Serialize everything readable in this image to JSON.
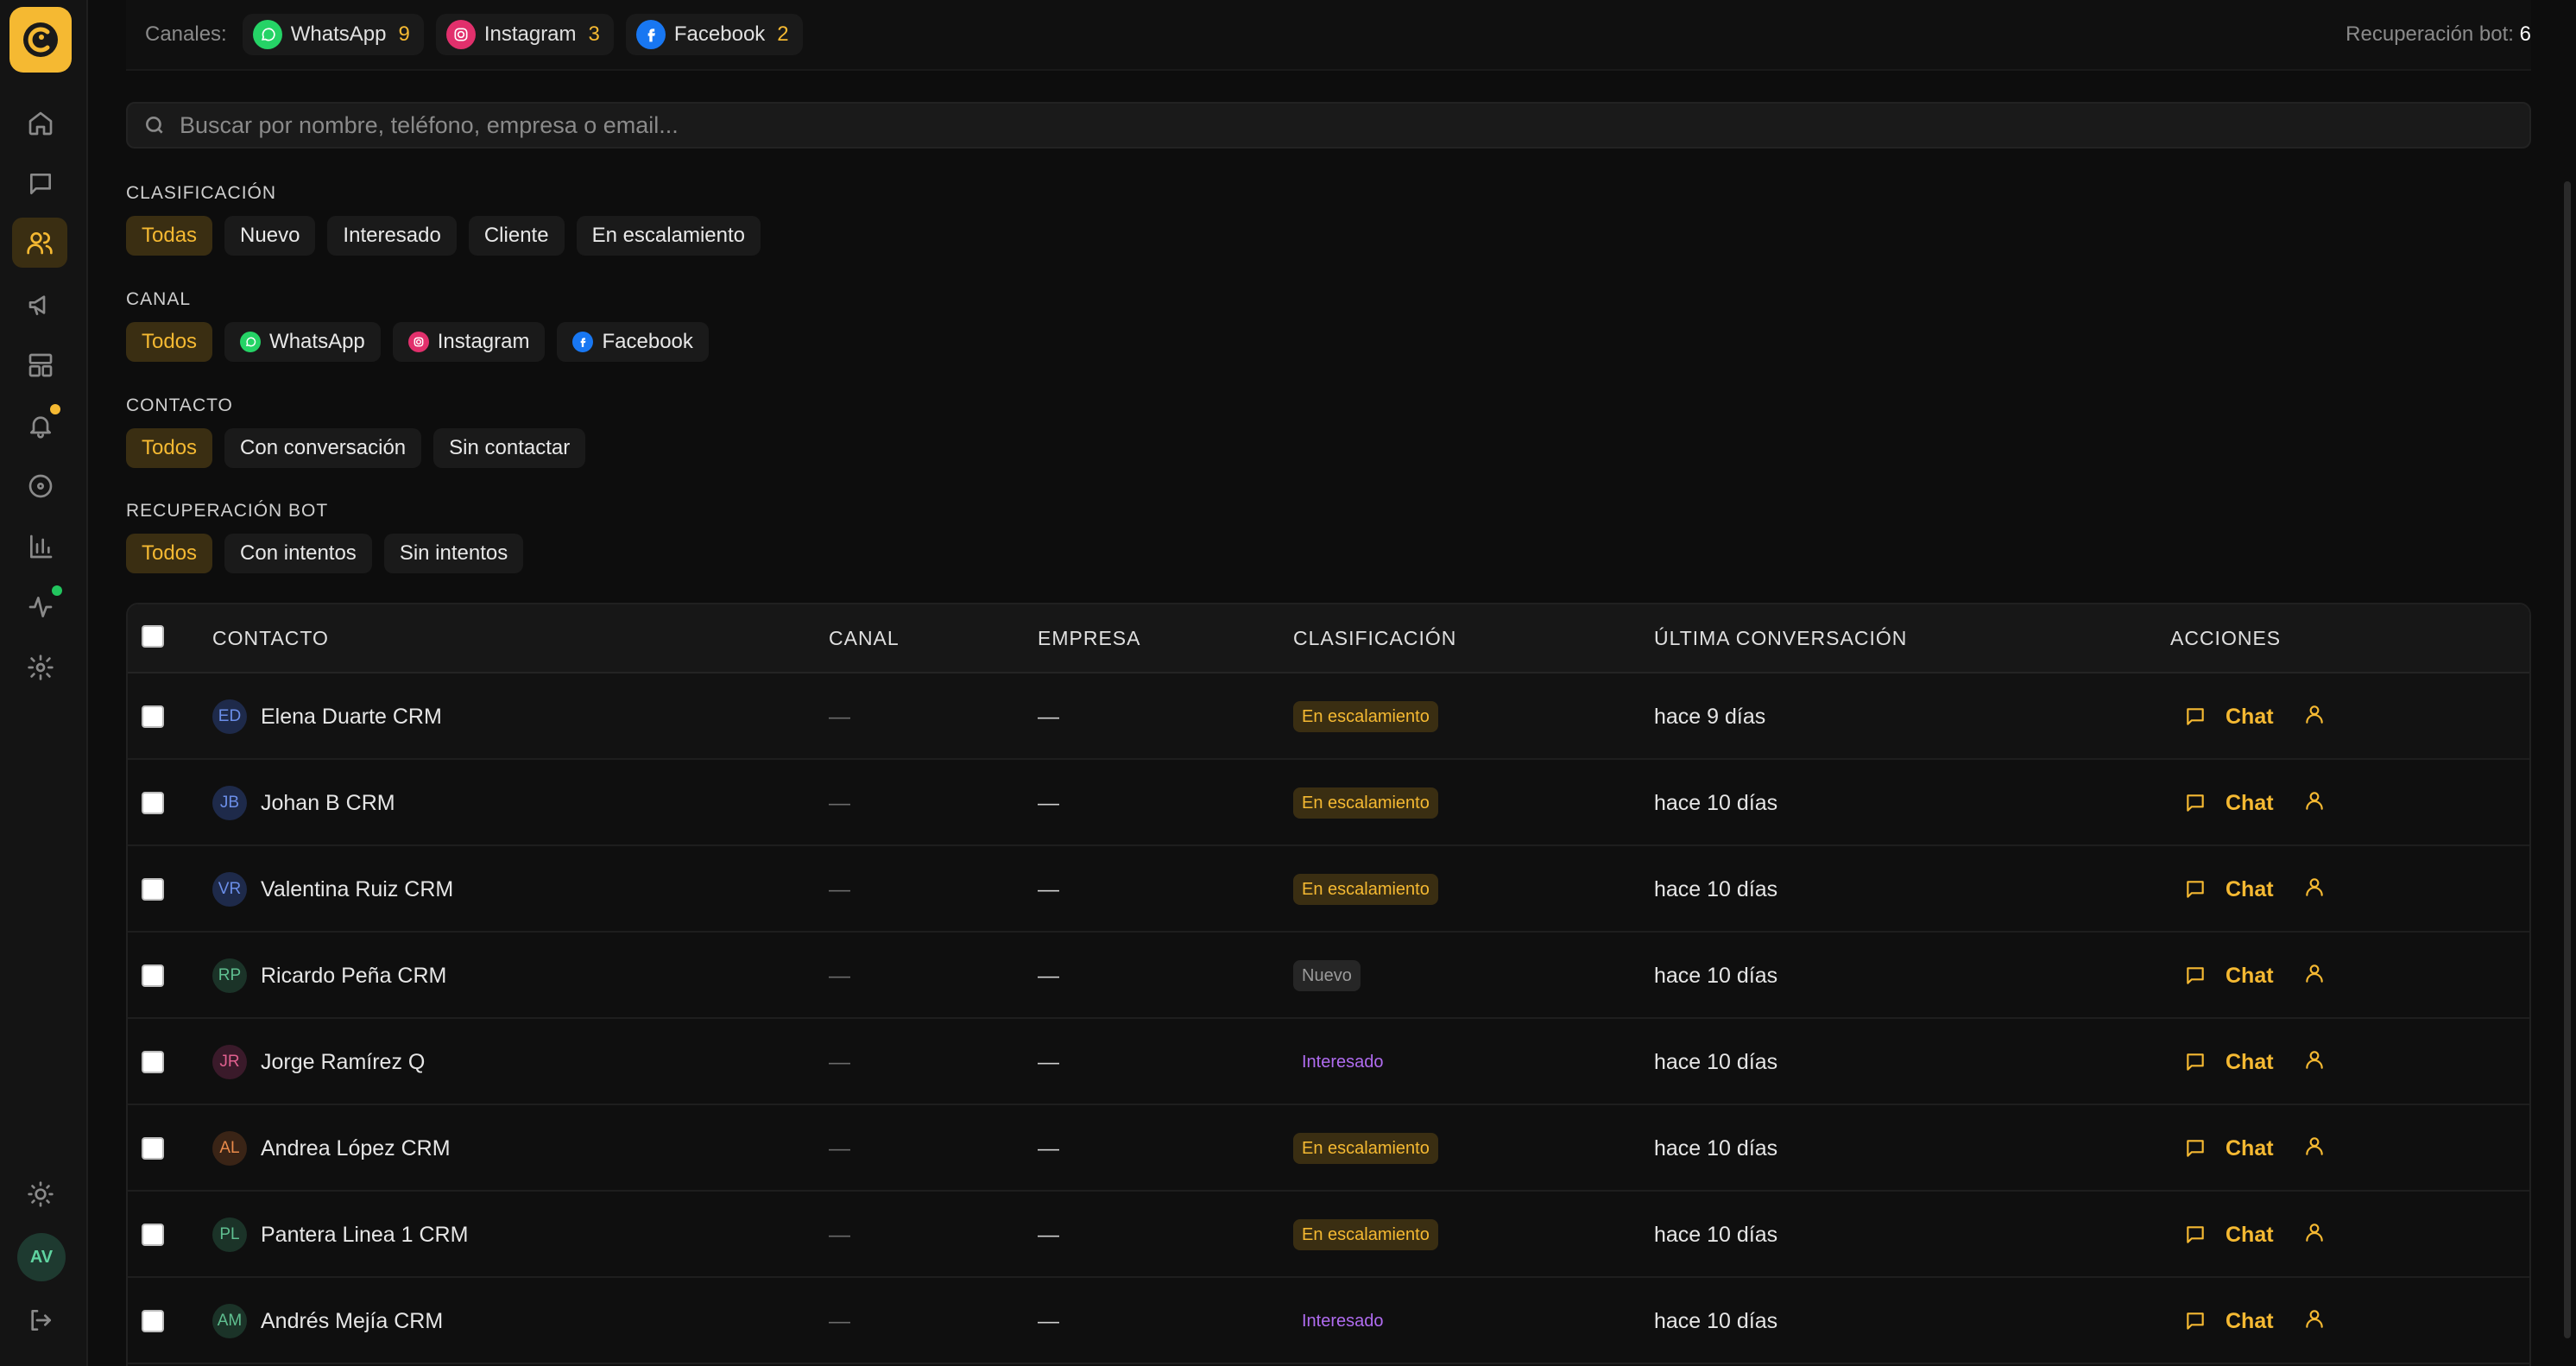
{
  "sidebar": {
    "items": [
      {
        "name": "home-icon"
      },
      {
        "name": "messages-icon"
      },
      {
        "name": "contacts-icon",
        "active": true
      },
      {
        "name": "megaphone-icon"
      },
      {
        "name": "layout-icon"
      },
      {
        "name": "bell-icon",
        "dot": "#f5b932"
      },
      {
        "name": "circle-dot-icon"
      },
      {
        "name": "bar-chart-icon"
      },
      {
        "name": "activity-icon",
        "dot": "#22c55e"
      },
      {
        "name": "gear-icon"
      }
    ],
    "user_initials": "AV"
  },
  "topbar": {
    "channels_label": "Canales:",
    "channels": [
      {
        "name": "WhatsApp",
        "count": "9",
        "color": "#25d366"
      },
      {
        "name": "Instagram",
        "count": "3",
        "color": "#e1306c"
      },
      {
        "name": "Facebook",
        "count": "2",
        "color": "#1877f2"
      }
    ],
    "recovery_label": "Recuperación bot:",
    "recovery_value": "6"
  },
  "search": {
    "placeholder": "Buscar por nombre, teléfono, empresa o email..."
  },
  "filters": {
    "clasificacion": {
      "title": "CLASIFICACIÓN",
      "options": [
        "Todas",
        "Nuevo",
        "Interesado",
        "Cliente",
        "En escalamiento"
      ]
    },
    "canal": {
      "title": "CANAL",
      "options": [
        "Todos",
        "WhatsApp",
        "Instagram",
        "Facebook"
      ]
    },
    "contacto": {
      "title": "CONTACTO",
      "options": [
        "Todos",
        "Con conversación",
        "Sin contactar"
      ]
    },
    "recuperacion": {
      "title": "RECUPERACIÓN BOT",
      "options": [
        "Todos",
        "Con intentos",
        "Sin intentos"
      ]
    }
  },
  "table": {
    "headers": {
      "contacto": "CONTACTO",
      "canal": "CANAL",
      "empresa": "EMPRESA",
      "clasificacion": "CLASIFICACIÓN",
      "ultima": "ÚLTIMA CONVERSACIÓN",
      "acciones": "ACCIONES"
    },
    "chat_label": "Chat",
    "rows": [
      {
        "initials": "ED",
        "name": "Elena Duarte CRM",
        "canal": "—",
        "empresa": "—",
        "clasificacion": "En escalamiento",
        "type": "esc",
        "ultima": "hace 9 días",
        "avbg": "#1e2a4a",
        "avfg": "#6b8ee8"
      },
      {
        "initials": "JB",
        "name": "Johan B CRM",
        "canal": "—",
        "empresa": "—",
        "clasificacion": "En escalamiento",
        "type": "esc",
        "ultima": "hace 10 días",
        "avbg": "#1e2a4a",
        "avfg": "#6b8ee8"
      },
      {
        "initials": "VR",
        "name": "Valentina Ruiz CRM",
        "canal": "—",
        "empresa": "—",
        "clasificacion": "En escalamiento",
        "type": "esc",
        "ultima": "hace 10 días",
        "avbg": "#1e2a4a",
        "avfg": "#6b8ee8"
      },
      {
        "initials": "RP",
        "name": "Ricardo Peña CRM",
        "canal": "—",
        "empresa": "—",
        "clasificacion": "Nuevo",
        "type": "nuevo",
        "ultima": "hace 10 días",
        "avbg": "#1b3328",
        "avfg": "#5fbf90"
      },
      {
        "initials": "JR",
        "name": "Jorge Ramírez Q",
        "canal": "—",
        "empresa": "—",
        "clasificacion": "Interesado",
        "type": "int",
        "ultima": "hace 10 días",
        "avbg": "#3a1a2a",
        "avfg": "#e0608f"
      },
      {
        "initials": "AL",
        "name": "Andrea López CRM",
        "canal": "—",
        "empresa": "—",
        "clasificacion": "En escalamiento",
        "type": "esc",
        "ultima": "hace 10 días",
        "avbg": "#3a2416",
        "avfg": "#e98a4a"
      },
      {
        "initials": "PL",
        "name": "Pantera Linea 1 CRM",
        "canal": "—",
        "empresa": "—",
        "clasificacion": "En escalamiento",
        "type": "esc",
        "ultima": "hace 10 días",
        "avbg": "#1b3328",
        "avfg": "#5fbf90"
      },
      {
        "initials": "AM",
        "name": "Andrés Mejía CRM",
        "canal": "—",
        "empresa": "—",
        "clasificacion": "Interesado",
        "type": "int",
        "ultima": "hace 10 días",
        "avbg": "#1b3328",
        "avfg": "#5fbf90"
      }
    ]
  }
}
